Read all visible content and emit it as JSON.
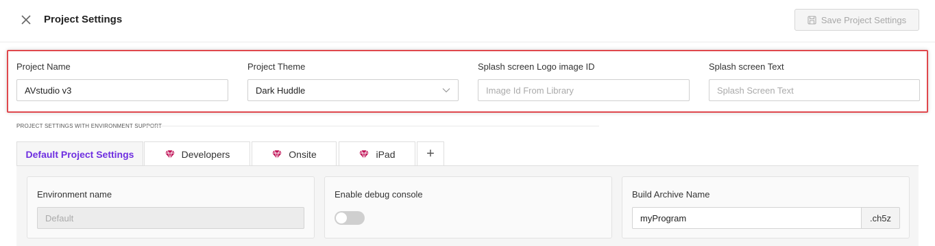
{
  "header": {
    "title": "Project Settings",
    "save_label": "Save Project Settings"
  },
  "fields": [
    {
      "label": "Project Name",
      "value": "AVstudio v3",
      "placeholder": ""
    },
    {
      "label": "Project Theme",
      "value": "Dark Huddle",
      "placeholder": ""
    },
    {
      "label": "Splash screen Logo image ID",
      "value": "",
      "placeholder": "Image Id From Library"
    },
    {
      "label": "Splash screen Text",
      "value": "",
      "placeholder": "Splash Screen Text"
    }
  ],
  "section": {
    "label": "PROJECT SETTINGS WITH ENVIRONMENT SUPPORT"
  },
  "tabs": [
    {
      "label": "Default Project Settings",
      "icon": "none",
      "active": true
    },
    {
      "label": "Developers",
      "icon": "gem-icon",
      "active": false
    },
    {
      "label": "Onsite",
      "icon": "gem-icon",
      "active": false
    },
    {
      "label": "iPad",
      "icon": "gem-icon",
      "active": false
    },
    {
      "label": "+",
      "icon": "plus-icon",
      "active": false
    }
  ],
  "cards": {
    "environment": {
      "label": "Environment name",
      "placeholder": "Default"
    },
    "debug": {
      "label": "Enable debug console",
      "enabled": false
    },
    "archive": {
      "label": "Build Archive Name",
      "value": "myProgram",
      "suffix": ".ch5z"
    }
  },
  "colors": {
    "accent": "#6e2ee0",
    "highlight": "#e0474c",
    "gem": "#c2185b"
  }
}
